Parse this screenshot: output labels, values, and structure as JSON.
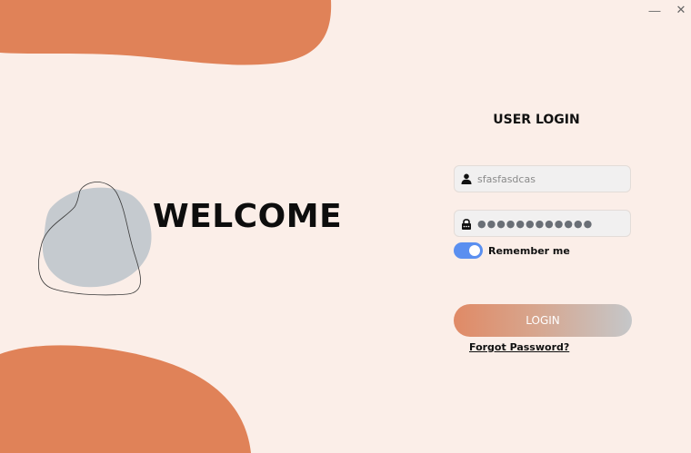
{
  "window": {
    "minimize_glyph": "—",
    "close_glyph": "✕"
  },
  "welcome": {
    "text": "WELCOME"
  },
  "login": {
    "title": "USER LOGIN",
    "username_value": "sfasfasdcas",
    "password_masked": "●●●●●●●●●●●●",
    "remember_label": "Remember me",
    "remember_checked": true,
    "button_label": "LOGIN",
    "forgot_label": "Forgot Password?"
  },
  "colors": {
    "background": "#fbeee8",
    "accent_orange": "#e08258",
    "blob_grey": "#c5cacf",
    "toggle_on": "#5a8ff0"
  },
  "icons": [
    "user-icon",
    "lock-icon",
    "minimize-icon",
    "close-icon"
  ]
}
